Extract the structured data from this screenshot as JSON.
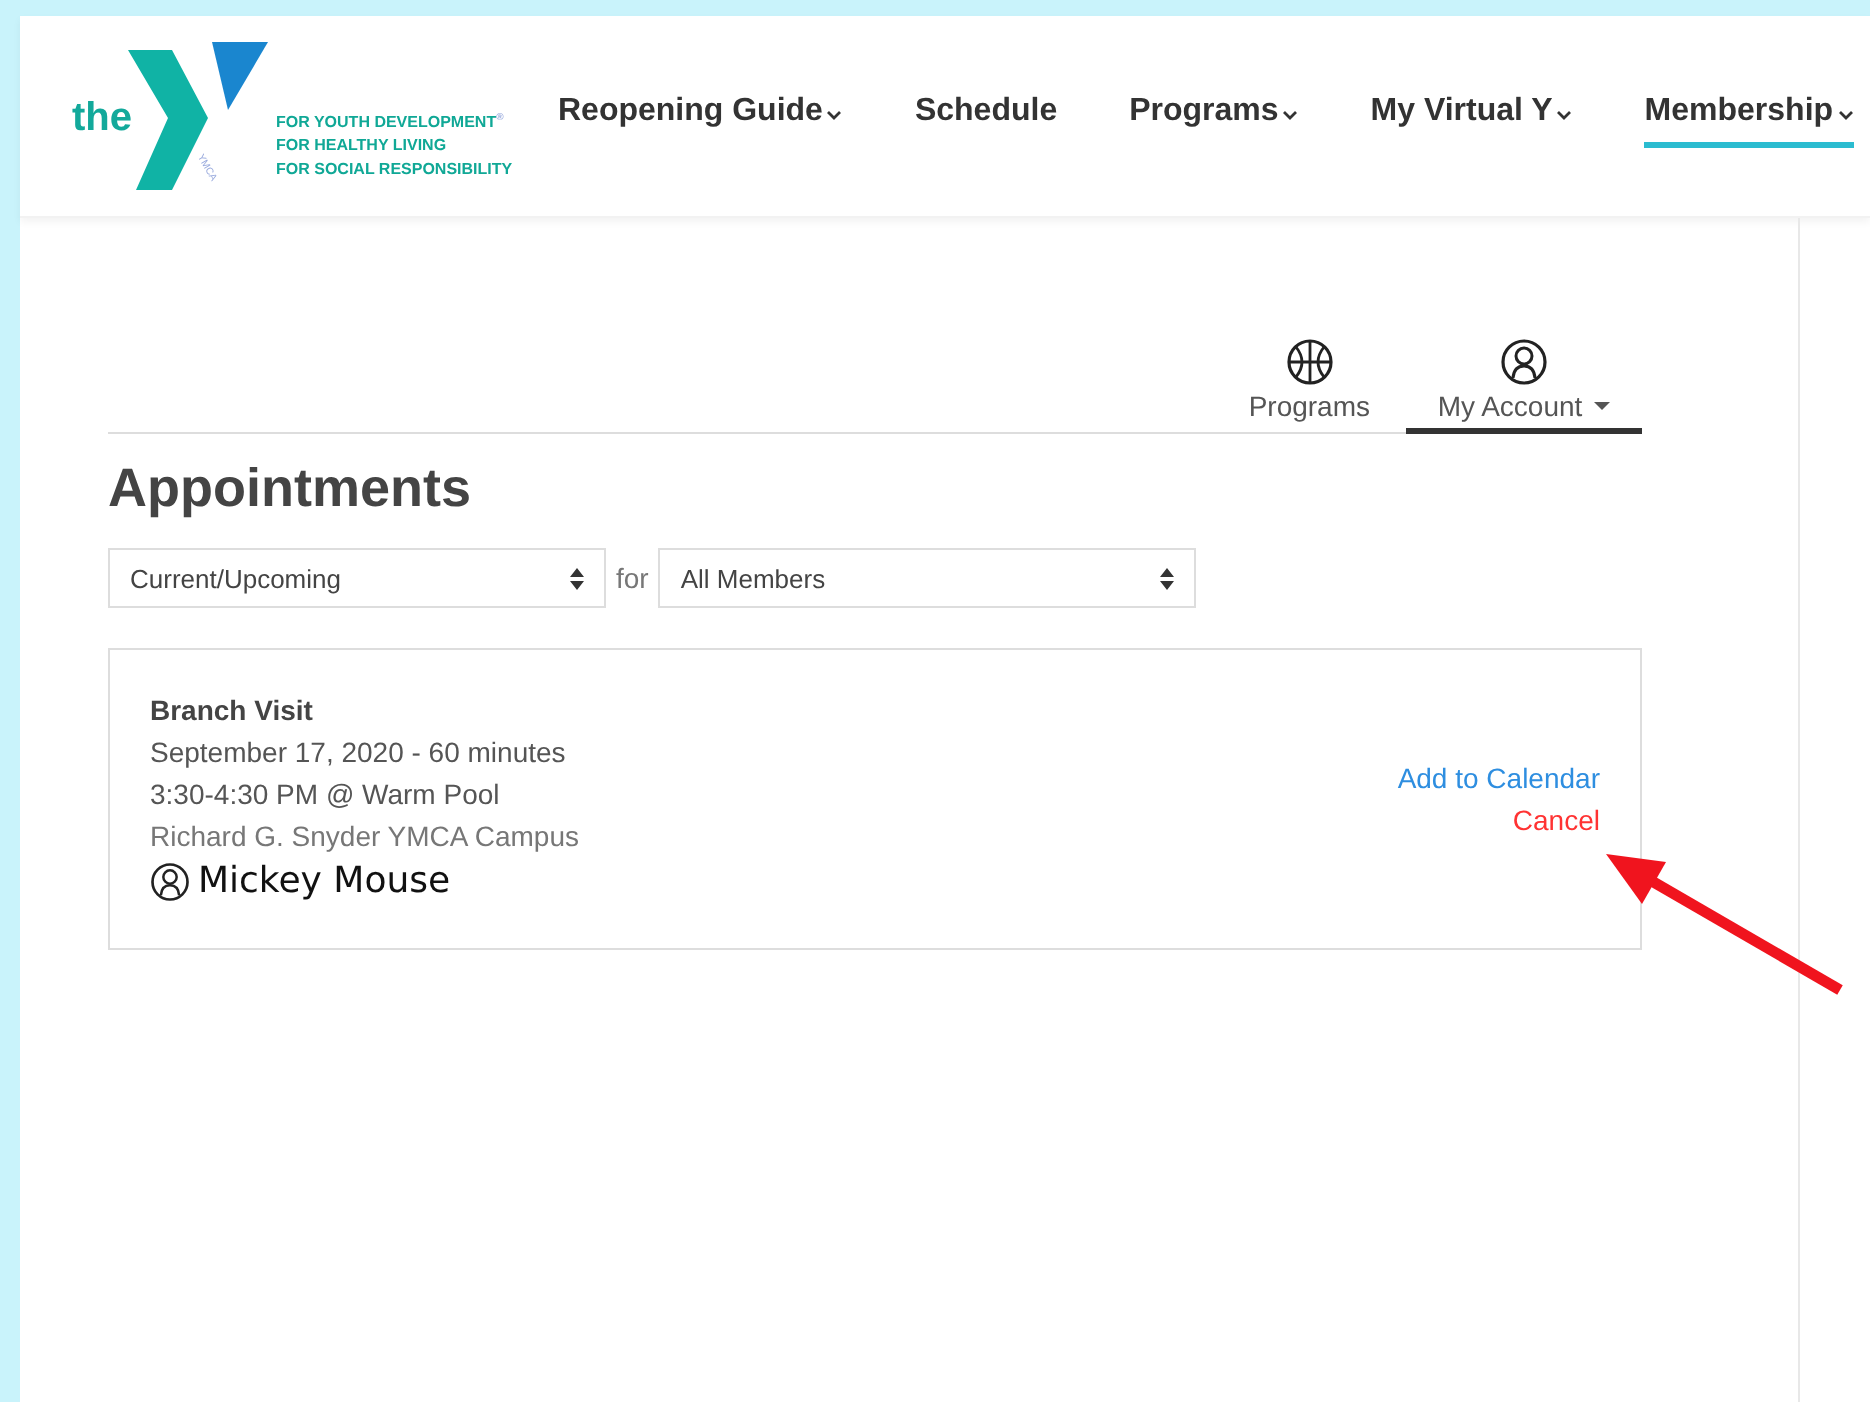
{
  "logo": {
    "word": "the",
    "mark": "YMCA",
    "taglines": [
      "FOR YOUTH DEVELOPMENT$^{®}$",
      "FOR HEALTHY LIVING",
      "FOR SOCIAL RESPONSIBILITY"
    ]
  },
  "nav": [
    {
      "label": "Reopening Guide",
      "dropdown": true,
      "selected": false
    },
    {
      "label": "Schedule",
      "dropdown": false,
      "selected": false
    },
    {
      "label": "Programs",
      "dropdown": true,
      "selected": false
    },
    {
      "label": "My Virtual Y",
      "dropdown": true,
      "selected": false
    },
    {
      "label": "Membership",
      "dropdown": true,
      "selected": true
    }
  ],
  "account_tabs": [
    {
      "label": "Programs",
      "kind": "sports",
      "dropdown": false,
      "selected": false
    },
    {
      "label": "My Account",
      "kind": "account",
      "dropdown": true,
      "selected": true
    }
  ],
  "heading": "Appointments",
  "filters": {
    "status": "Current/Upcoming",
    "joiner": "for",
    "member": "All Members"
  },
  "appointments": [
    {
      "title": "Branch Visit",
      "date": "September 17, 2020 - 60 minutes",
      "time": "3:30-4:30 PM @ Warm Pool",
      "location": "Richard G. Snyder YMCA Campus",
      "member": "Mickey Mouse",
      "actions": [
        {
          "kind": "calendar",
          "label": "Add to Calendar"
        },
        {
          "kind": "cancel",
          "label": "Cancel"
        }
      ]
    }
  ],
  "annotation": {
    "kind": "arrow"
  }
}
